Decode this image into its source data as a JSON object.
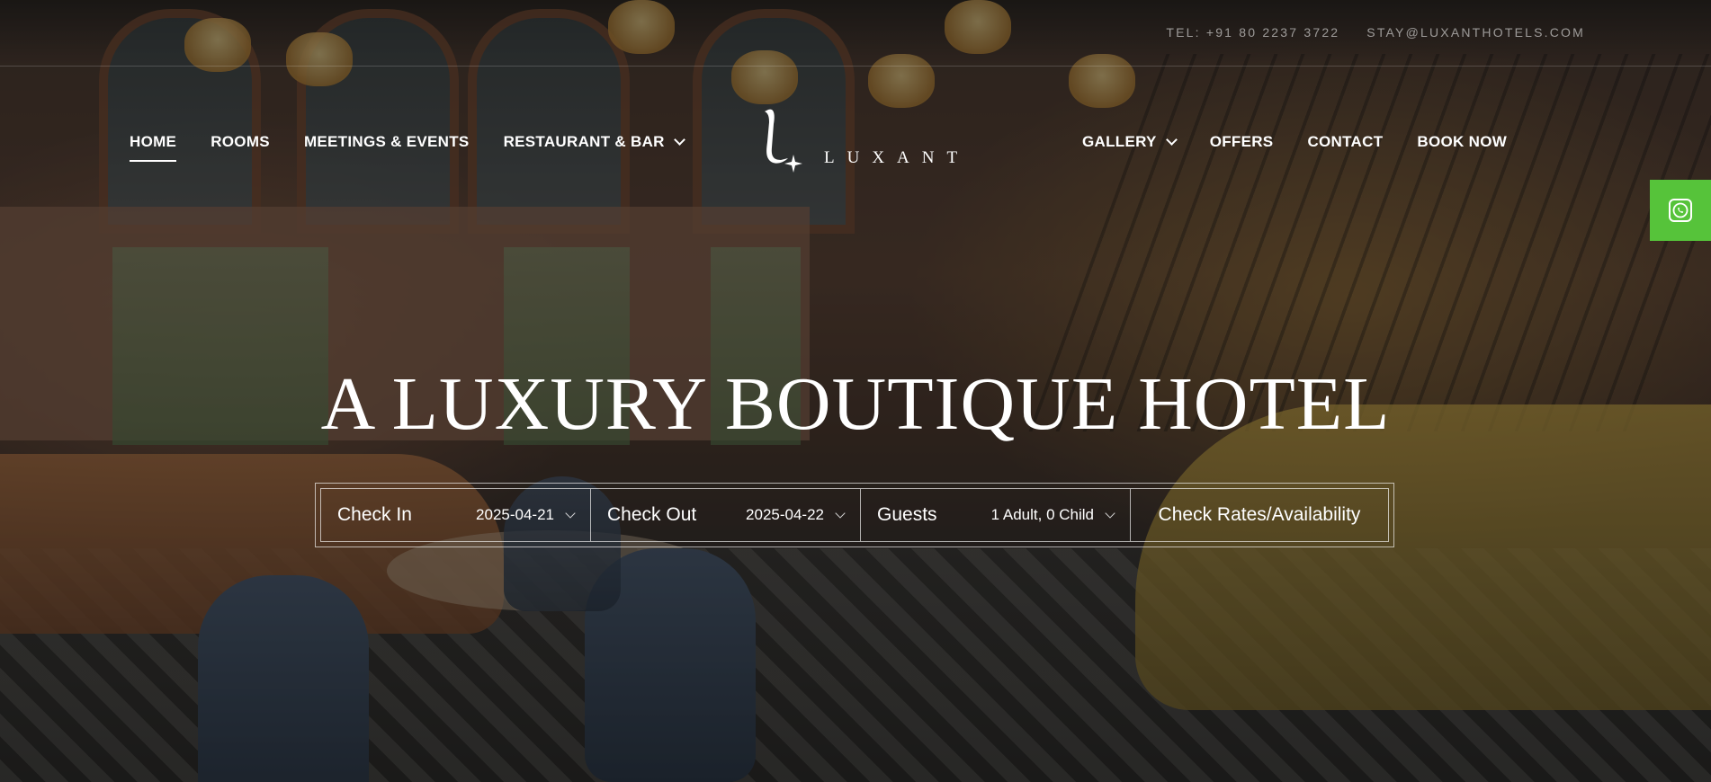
{
  "topbar": {
    "phone": "TEL: +91 80 2237 3722",
    "email": "STAY@LUXANTHOTELS.COM"
  },
  "nav_left": [
    {
      "label": "HOME",
      "active": true
    },
    {
      "label": "ROOMS"
    },
    {
      "label": "MEETINGS & EVENTS"
    },
    {
      "label": "RESTAURANT & BAR",
      "dropdown": true
    }
  ],
  "nav_right": [
    {
      "label": "GALLERY",
      "dropdown": true
    },
    {
      "label": "OFFERS"
    },
    {
      "label": "CONTACT"
    },
    {
      "label": "BOOK NOW"
    }
  ],
  "logo": {
    "text": "LUXANT"
  },
  "hero": {
    "headline": "A LUXURY BOUTIQUE HOTEL"
  },
  "booking": {
    "check_in": {
      "label": "Check In",
      "value": "2025-04-21"
    },
    "check_out": {
      "label": "Check Out",
      "value": "2025-04-22"
    },
    "guests": {
      "label": "Guests",
      "value": "1 Adult, 0 Child"
    },
    "cta_label": "Check Rates/Availability"
  },
  "colors": {
    "whatsapp": "#56c33a",
    "text": "#ffffff"
  },
  "icons": {
    "whatsapp": "whatsapp-icon",
    "dropdown": "chevron-down-icon"
  }
}
